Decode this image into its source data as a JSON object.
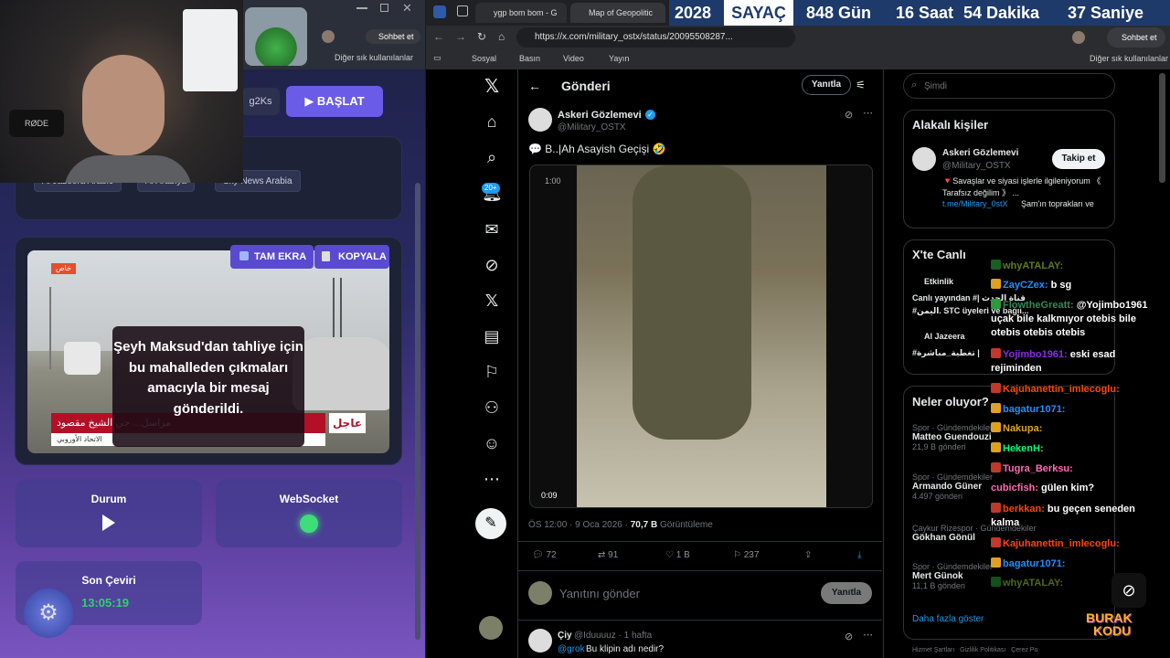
{
  "left_app": {
    "partial_button": "g2Ks",
    "start_button": "▶ BAŞLAT",
    "sources": [
      "Al Jazeera Arabic",
      "Al Arabiya",
      "Sky News Arabia"
    ],
    "fullscreen_button": "TAM EKRA",
    "copy_button": "KOPYALA",
    "news_tag": "خاص",
    "breaking_label": "عاجل",
    "lower_third": "مراسل...  حي الشيخ مقصود",
    "lower_third_sub": "الاتحاد الأوروبي",
    "caption": "Şeyh Maksud'dan tahliye için bu mahalleden çıkmaları amacıyla bir mesaj gönderildi.",
    "status_label": "Durum",
    "websocket_label": "WebSocket",
    "last_translation_label": "Son Çeviri",
    "last_translation_time": "13:05:19",
    "bookmarks_other": "Diğer sık kullanılanlar",
    "profile_button": "Sohbet et"
  },
  "right_browser": {
    "tabs": [
      "ygp bom bom - G",
      "Map of Geopolitic"
    ],
    "countdown": {
      "year": "2028",
      "label": "SAYAÇ",
      "days": "848 Gün",
      "hours": "16 Saat",
      "minutes": "54 Dakika",
      "seconds": "37 Saniye"
    },
    "url": "https://x.com/military_ostx/status/20095508287...",
    "chat_button": "Sohbet et",
    "bookmarks": [
      "Sosyal",
      "Basın",
      "Video",
      "Yayın"
    ],
    "bookmarks_other": "Diğer sık kullanılanlar"
  },
  "x_page": {
    "nav_badge": "20+",
    "header_title": "Gönderi",
    "reply_pill": "Yanıtla",
    "author_name": "Askeri Gözlemevi",
    "author_handle": "@Military_OSTX",
    "post_text": "💬 B..|Ah Asayish Geçişi 🤣",
    "video_time_top": "1:00",
    "video_time_bottom": "0:09",
    "post_meta": "ÖS 12:00 · 9 Oca 2026 ·",
    "views_count": "70,7 B",
    "views_label": "Görüntüleme",
    "replies": "72",
    "reposts": "91",
    "likes": "1 B",
    "bookmarks": "237",
    "reply_placeholder": "Yanıtını gönder",
    "reply_button": "Yanıtla",
    "reply_author": "Çiy",
    "reply_handle": "@Iduuuuz · 1 hafta",
    "reply_mention": "@grok",
    "reply_text": "Bu klipin adı nedir?",
    "search_placeholder": "Şimdi",
    "related_title": "Alakalı kişiler",
    "related_name": "Askeri Gözlemevi",
    "related_handle": "@Military_OSTX",
    "follow_button": "Takip et",
    "related_bio": "🔻Savaşlar ve siyasi işlerle ilgileniyorum 《 Tarafsız değilim 》 ...",
    "related_link": "t.me/Military_0stX",
    "related_bio2": "Şam'ın toprakları ve",
    "live_title": "X'te Canlı",
    "live_1_name": "Etkinlik",
    "live_1_text": "Canlı yayından #| قناة الحدث",
    "live_1_text2": "#اليمن. STC üyeleri ve bağıl...",
    "live_2_name": "Al Jazeera",
    "live_2_text": "#تغطية_مباشرة |",
    "whats_happening": "Neler oluyor?",
    "trends": [
      {
        "cat": "Spor · Gündemdekiler",
        "title": "Matteo Guendouzi",
        "count": "21,9 B gönderi"
      },
      {
        "cat": "Spor · Gündemdekiler",
        "title": "Armando Güner",
        "count": "4.497 gönderi"
      },
      {
        "cat": "Çaykur Rizespor · Gündemdekiler",
        "title": "Gökhan Gönül",
        "count": ""
      },
      {
        "cat": "Spor · Gündemdekiler",
        "title": "Mert Günok",
        "count": "11,1 B gönderi"
      }
    ],
    "show_more": "Daha fazla göster",
    "footer": [
      "Hizmet Şartları",
      "Gizlilik Politikası",
      "Çerez Po"
    ]
  },
  "chat": [
    {
      "user": "whyATALAY:",
      "msg": "",
      "color": "#9acd32"
    },
    {
      "user": "ZayCZex:",
      "msg": "b sg",
      "color": "#1e90ff"
    },
    {
      "user": "FlowtheGreatt:",
      "msg": "@Yojimbo1961 uçak bile kalkmıyor otebis bile otebis otebis otebis",
      "color": "#2e8b57"
    },
    {
      "user": "Yojimbo1961:",
      "msg": "eski esad rejiminden",
      "color": "#8a2be2"
    },
    {
      "user": "Kajuhanettin_imlecoglu:",
      "msg": "",
      "color": "#ff4500"
    },
    {
      "user": "bagatur1071:",
      "msg": "",
      "color": "#1e90ff"
    },
    {
      "user": "Nakupa:",
      "msg": "",
      "color": "#daa520"
    },
    {
      "user": "HekenH:",
      "msg": "",
      "color": "#00ff7f"
    },
    {
      "user": "Tugra_Berksu:",
      "msg": "",
      "color": "#ff69b4"
    },
    {
      "user": "cubicfish:",
      "msg": "gülen kim?",
      "color": "#ff69b4"
    },
    {
      "user": "berkkan:",
      "msg": "bu geçen seneden kalma",
      "color": "#ff4500"
    },
    {
      "user": "Kajuhanettin_imlecoglu:",
      "msg": "",
      "color": "#ff4500"
    },
    {
      "user": "bagatur1071:",
      "msg": "",
      "color": "#1e90ff"
    },
    {
      "user": "whyATALAY:",
      "msg": "",
      "color": "#9acd32"
    }
  ],
  "logo": {
    "line1": "BURAK",
    "line2": "KODU"
  },
  "colors": {
    "accent": "#6b5ce7",
    "x_blue": "#1d9bf0",
    "countdown_bg": "#1d3a6b"
  }
}
